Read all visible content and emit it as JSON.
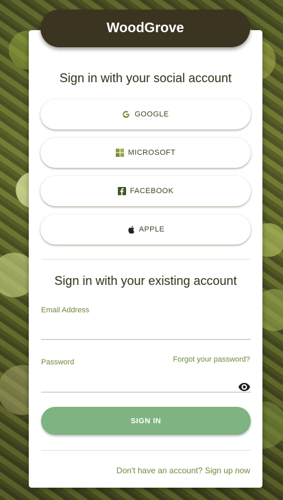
{
  "brand": {
    "name": "WoodGrove"
  },
  "social": {
    "heading": "Sign in with your social account",
    "buttons": [
      {
        "label": "GOOGLE",
        "icon": "google-icon"
      },
      {
        "label": "MICROSOFT",
        "icon": "microsoft-icon"
      },
      {
        "label": "FACEBOOK",
        "icon": "facebook-icon"
      },
      {
        "label": "APPLE",
        "icon": "apple-icon"
      }
    ]
  },
  "local": {
    "heading": "Sign in with your existing account",
    "email_label": "Email Address",
    "email_value": "",
    "password_label": "Password",
    "password_value": "",
    "forgot_label": "Forgot your password?",
    "show_password_icon": "eye-icon",
    "sign_in_label": "SIGN IN",
    "signup_label": "Don't have an account? Sign up now"
  },
  "colors": {
    "brand_pill": "#3a3420",
    "accent_green": "#7fb381",
    "link_green": "#6d8a3c",
    "heading_text": "#2f3318"
  }
}
